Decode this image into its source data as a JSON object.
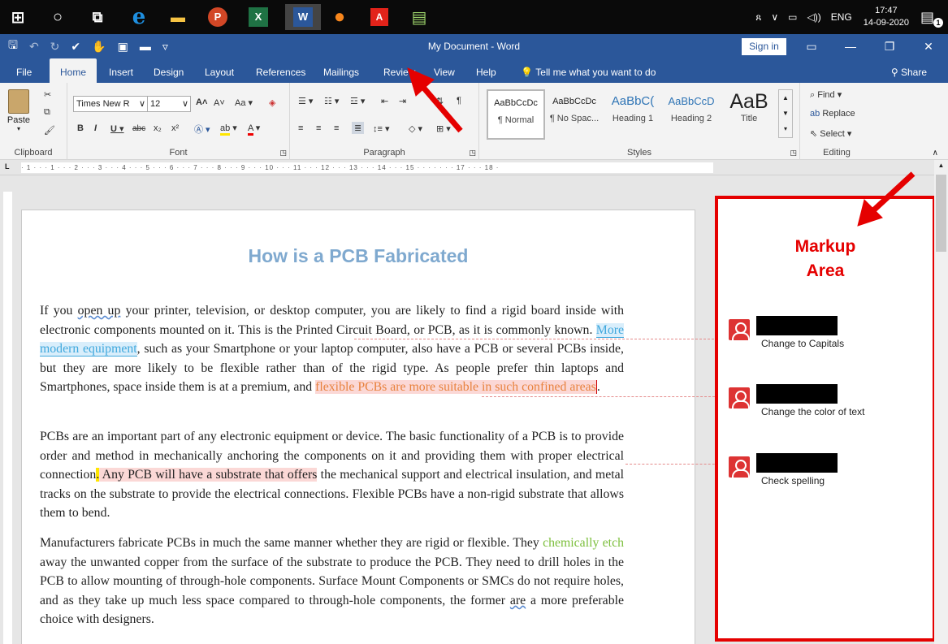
{
  "taskbar": {
    "apps": [
      {
        "name": "windows-start-icon",
        "glyph": "⊞"
      },
      {
        "name": "search-circle-icon",
        "glyph": "○"
      },
      {
        "name": "task-view-icon",
        "glyph": "⧉"
      },
      {
        "name": "edge-icon",
        "glyph": "e"
      },
      {
        "name": "file-explorer-icon",
        "glyph": "▬"
      },
      {
        "name": "powerpoint-icon",
        "glyph": "P"
      },
      {
        "name": "excel-icon",
        "glyph": "X"
      },
      {
        "name": "word-icon",
        "glyph": "W"
      },
      {
        "name": "firefox-icon",
        "glyph": "●"
      },
      {
        "name": "acrobat-icon",
        "glyph": "A"
      },
      {
        "name": "notepad-icon",
        "glyph": "▤"
      }
    ],
    "language": "ENG",
    "time": "17:47",
    "date": "14-09-2020",
    "notification_count": "1"
  },
  "titlebar": {
    "title": "My Document - Word",
    "sign_in": "Sign in"
  },
  "ribbon_tabs": [
    "File",
    "Home",
    "Insert",
    "Design",
    "Layout",
    "References",
    "Mailings",
    "Review",
    "View",
    "Help"
  ],
  "tell_me": "Tell me what you want to do",
  "share": "Share",
  "ribbon": {
    "clipboard": {
      "paste": "Paste",
      "label": "Clipboard"
    },
    "font": {
      "name": "Times New R",
      "size": "12",
      "label": "Font",
      "case": "Aa"
    },
    "paragraph": {
      "label": "Paragraph"
    },
    "styles": {
      "label": "Styles",
      "items": [
        {
          "sample": "AaBbCcDc",
          "name": "¶ Normal"
        },
        {
          "sample": "AaBbCcDc",
          "name": "¶ No Spac..."
        },
        {
          "sample": "AaBbC(",
          "name": "Heading 1"
        },
        {
          "sample": "AaBbCcD",
          "name": "Heading 2"
        },
        {
          "sample": "AaB",
          "name": "Title"
        }
      ]
    },
    "editing": {
      "find": "Find",
      "replace": "Replace",
      "select": "Select",
      "label": "Editing"
    }
  },
  "document": {
    "heading": "How is a PCB Fabricated",
    "p1": {
      "a": "If you ",
      "b": "open up",
      "c": " your printer, television, or desktop computer, you are likely to find a rigid board inside with electronic components mounted on it. This is the Printed Circuit Board, or PCB, as it is commonly known. ",
      "blue": "More modern equipment",
      "d": ", such as your Smartphone or your laptop computer, also have a PCB or several PCBs inside, but they are more likely to be flexible rather than of the rigid type. As people prefer thin laptops and Smartphones, space inside them is at a premium, and ",
      "orange": "flexible PCBs are more suitable in such confined areas",
      "e": "."
    },
    "p2": {
      "a": "PCBs are an important part of any electronic equipment or device. The basic functionality of a PCB is to provide order and method in mechanically anchoring the components on it and providing them with proper electrical connection",
      "yellow": ".",
      "pink": " Any PCB will have a substrate that offers",
      "b": " the mechanical support and electrical insulation, and metal tracks on the substrate to provide the electrical connections. Flexible PCBs have a non-rigid substrate that allows them to bend."
    },
    "p3": {
      "a": "Manufacturers fabricate PCBs in much the same manner whether they are rigid or flexible. They ",
      "green": "chemically etch",
      "b": " away the unwanted copper from the surface of the substrate to produce the PCB. They need to drill holes in the PCB to allow mounting of through-hole components. Surface Mount Components or SMCs do not require holes, and as they take up much less space compared to through-hole components, the former ",
      "c": "are",
      "d": " a more preferable choice with designers."
    }
  },
  "markup": {
    "title_line1": "Markup",
    "title_line2": "Area",
    "comments": [
      {
        "text": "Change to Capitals"
      },
      {
        "text": "Change the color of text"
      },
      {
        "text": "Check spelling"
      }
    ]
  },
  "ruler": {
    "scale": "· 1 · · · 1 · · · 2 · · · 3 · · · 4 · · · 5 · · · 6 · · · 7 · · · 8 · · · 9 · · · 10 · · · 11 · · · 12 · · · 13 · · · 14 · · · 15 · · · · · · · 17 · · · 18 ·"
  },
  "colors": {
    "word_blue": "#2b579a",
    "annotation_red": "#e50000",
    "heading_blue": "#7fa9cf"
  }
}
